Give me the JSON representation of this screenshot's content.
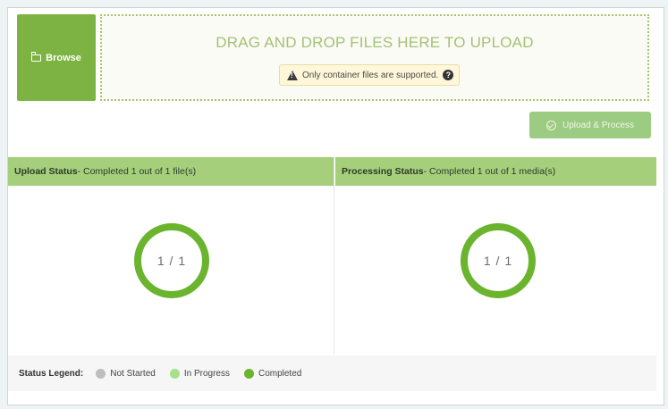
{
  "uploader": {
    "browse_label": "Browse",
    "dropzone_text": "DRAG AND DROP FILES HERE TO UPLOAD",
    "warning_text": "Only container files are supported.",
    "help_glyph": "?",
    "upload_process_label": "Upload & Process"
  },
  "upload_status": {
    "title": "Upload Status",
    "detail": " - Completed 1 out of 1 file(s)",
    "ring_text": "1 / 1",
    "completed": 1,
    "total": 1
  },
  "processing_status": {
    "title": "Processing Status",
    "detail": " - Completed 1 out of 1 media(s)",
    "ring_text": "1 / 1",
    "completed": 1,
    "total": 1
  },
  "legend": {
    "title": "Status Legend:",
    "items": [
      {
        "label": "Not Started",
        "color": "#bdbdbd"
      },
      {
        "label": "In Progress",
        "color": "#a6e08a"
      },
      {
        "label": "Completed",
        "color": "#6ab42e"
      }
    ]
  },
  "colors": {
    "accent": "#7cb342",
    "header": "#a6cf7c",
    "ring": "#6ab42e"
  },
  "icons": {
    "browse": "folder-icon",
    "warning": "warning-icon",
    "help": "help-icon",
    "upload": "check-circle-icon"
  }
}
